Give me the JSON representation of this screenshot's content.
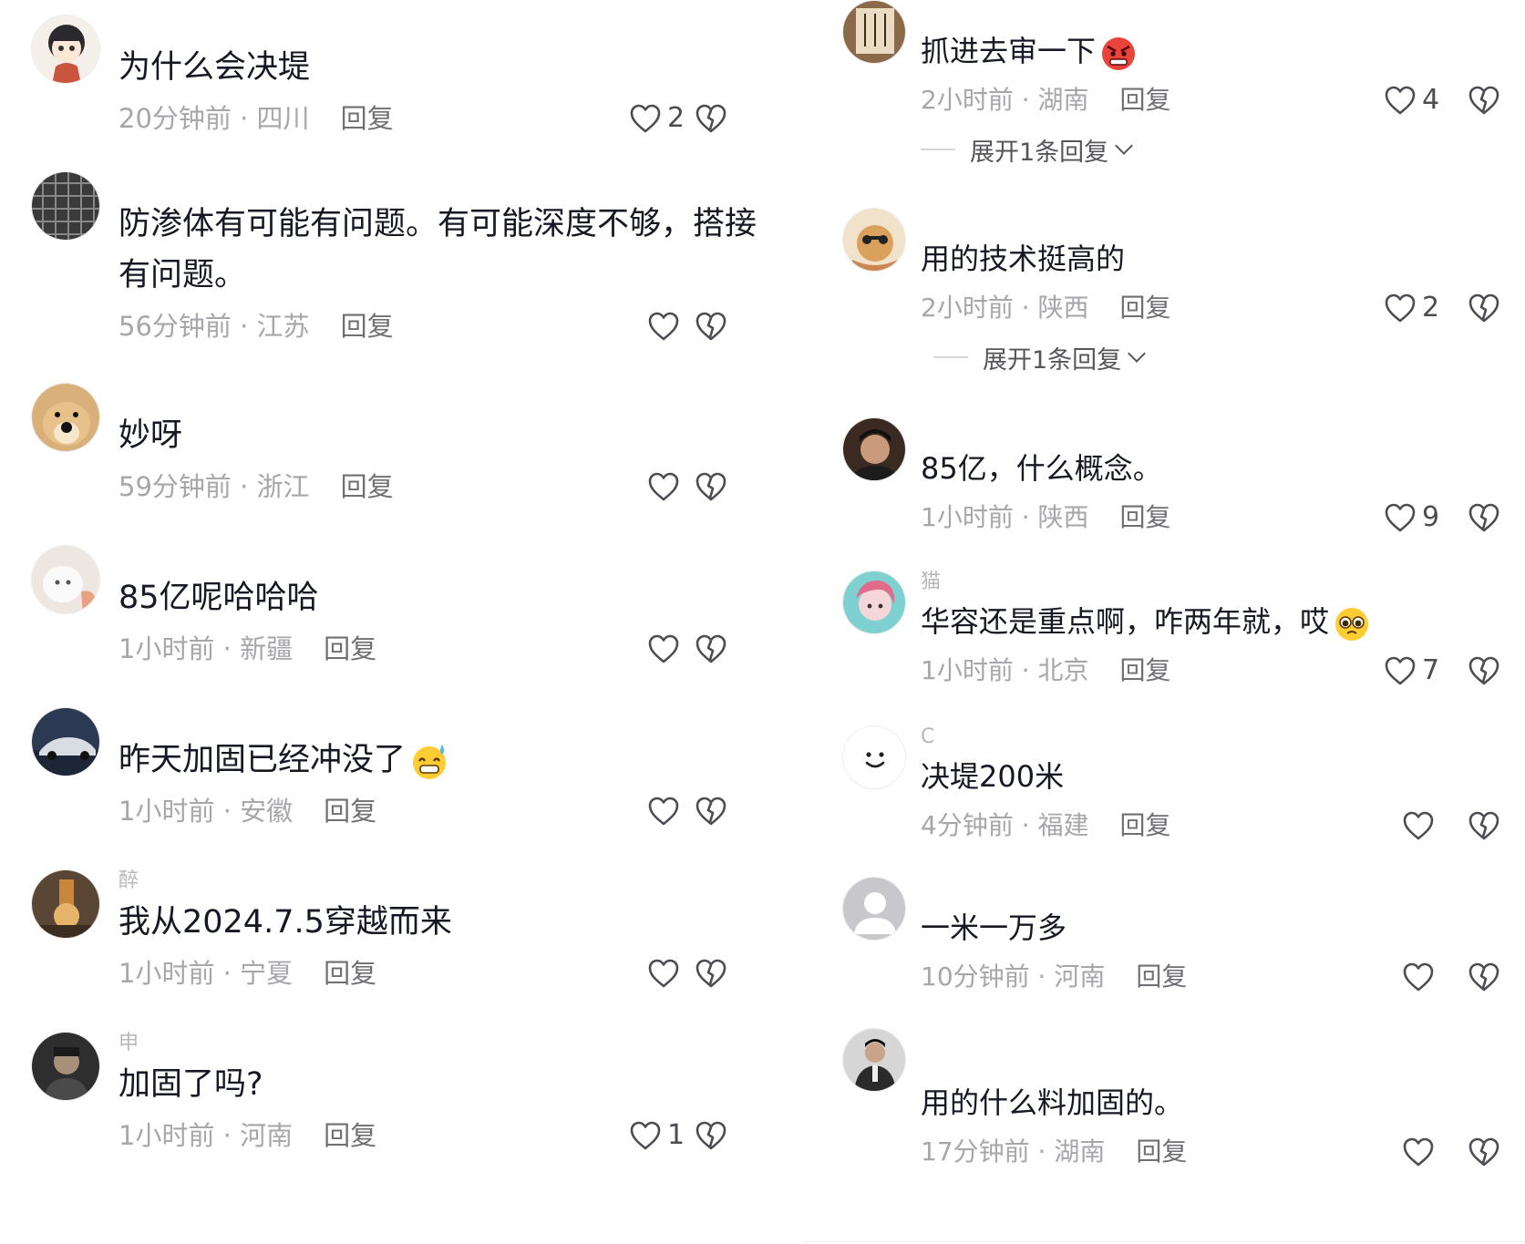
{
  "actions": {
    "reply_label": "回复"
  },
  "left_comments": [
    {
      "username": "",
      "text": "为什么会决堤",
      "time_location": "20分钟前 · 四川",
      "likes": "2",
      "avatar": "anime-girl-avatar"
    },
    {
      "username": "",
      "text": "防渗体有可能有问题。有可能深度不够，搭接有问题。",
      "time_location": "56分钟前 · 江苏",
      "likes": "",
      "avatar": "dark-grid-avatar"
    },
    {
      "username": "",
      "text": "妙呀",
      "time_location": "59分钟前 · 浙江",
      "likes": "",
      "avatar": "shiba-dog-avatar"
    },
    {
      "username": "",
      "text": "85亿呢哈哈哈",
      "time_location": "1小时前 · 新疆",
      "likes": "",
      "avatar": "white-cat-avatar"
    },
    {
      "username": "",
      "text": "昨天加固已经冲没了",
      "emoji": "sweat-grin-emoji",
      "time_location": "1小时前 · 安徽",
      "likes": "",
      "avatar": "sports-car-avatar"
    },
    {
      "username": "醉",
      "text": "我从2024.7.5穿越而来",
      "time_location": "1小时前 · 宁夏",
      "likes": "",
      "avatar": "lamp-room-avatar"
    },
    {
      "username": "申",
      "text": "加固了吗?",
      "time_location": "1小时前 · 河南",
      "likes": "1",
      "avatar": "man-portrait-avatar"
    }
  ],
  "right_comments": [
    {
      "username": "",
      "text": "抓进去审一下",
      "emoji": "angry-face-emoji",
      "time_location": "2小时前 · 湖南",
      "likes": "4",
      "avatar": "calligraphy-avatar",
      "expand": "展开1条回复"
    },
    {
      "username": "",
      "text": "用的技术挺高的",
      "time_location": "2小时前 · 陕西",
      "likes": "2",
      "avatar": "cartoon-bear-avatar",
      "expand": "展开1条回复"
    },
    {
      "username": "",
      "text": "85亿，什么概念。",
      "time_location": "1小时前 · 陕西",
      "likes": "9",
      "avatar": "man-dark-hair-avatar"
    },
    {
      "username": "猫",
      "text": "华容还是重点啊，咋两年就，哎",
      "emoji": "pleading-face-emoji",
      "time_location": "1小时前 · 北京",
      "likes": "7",
      "avatar": "painted-girl-avatar"
    },
    {
      "username": "C",
      "text": "决堤200米",
      "time_location": "4分钟前 · 福建",
      "likes": "",
      "avatar": "smiley-avatar"
    },
    {
      "username": "",
      "text": "一米一万多",
      "time_location": "10分钟前 · 河南",
      "likes": "",
      "avatar": "default-user-avatar"
    },
    {
      "username": "",
      "text": "用的什么料加固的。",
      "time_location": "17分钟前 · 湖南",
      "likes": "",
      "avatar": "man-suit-avatar"
    }
  ],
  "colors": {
    "text": "#161823",
    "meta": "#a6a6ab",
    "reply": "#6f6f74",
    "icon": "#4c4c52"
  }
}
